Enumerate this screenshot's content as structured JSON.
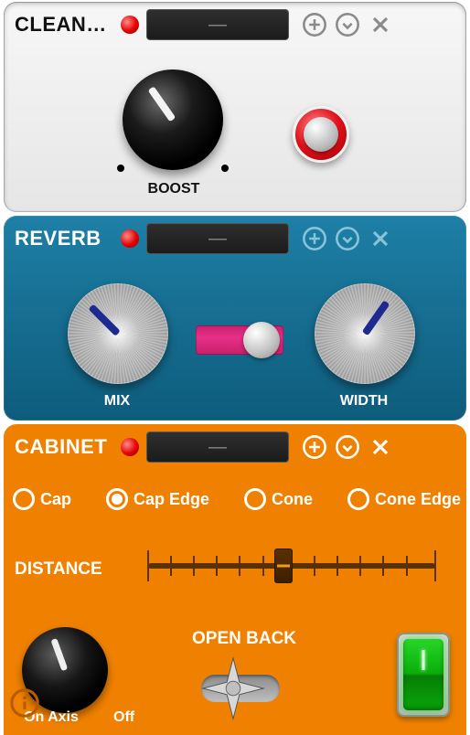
{
  "panels": {
    "clean": {
      "title": "CLEANB...",
      "lcd": "—",
      "knobs": {
        "boost": {
          "label": "BOOST",
          "angle_deg": -35,
          "dots": true
        }
      },
      "redButton": true
    },
    "reverb": {
      "title": "REVERB",
      "lcd": "—",
      "knobs": {
        "mix": {
          "label": "MIX",
          "angle_deg": -45
        },
        "width": {
          "label": "WIDTH",
          "angle_deg": 35
        }
      },
      "toggle": {
        "position": "right"
      }
    },
    "cabinet": {
      "title": "CABINET",
      "lcd": "—",
      "radios": {
        "options": [
          {
            "id": "cap",
            "label": "Cap"
          },
          {
            "id": "cap-edge",
            "label": "Cap Edge"
          },
          {
            "id": "cone",
            "label": "Cone"
          },
          {
            "id": "cone-edge",
            "label": "Cone Edge"
          }
        ],
        "selected": "cap-edge"
      },
      "distance": {
        "label": "DISTANCE",
        "value_pct": 47
      },
      "axis": {
        "on_label": "On Axis",
        "off_label": "Off",
        "angle_deg": -20
      },
      "open_back": {
        "label": "OPEN BACK"
      },
      "power": {
        "state": "on"
      }
    }
  }
}
